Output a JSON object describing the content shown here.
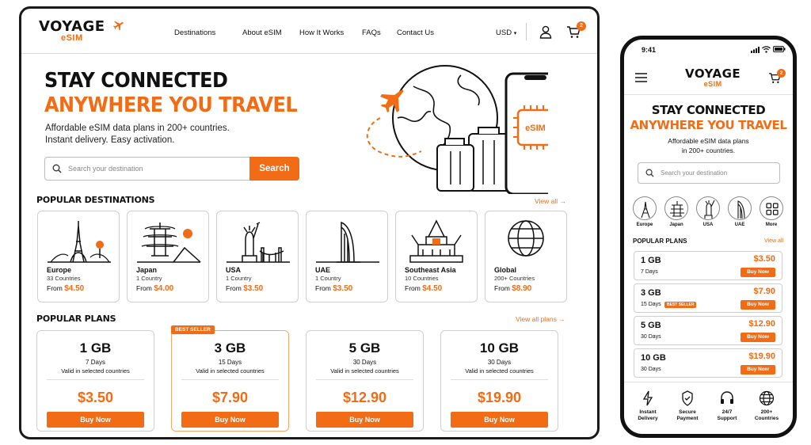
{
  "brand": {
    "name": "VOYAGE",
    "sub": "eSIM",
    "accent": "#f26c16"
  },
  "desktop": {
    "nav": [
      "Destinations",
      "About eSIM",
      "How It Works",
      "FAQs",
      "Contact Us"
    ],
    "currency": "USD",
    "cart_count": "2",
    "hero": {
      "line1": "STAY CONNECTED",
      "line2": "ANYWHERE YOU TRAVEL",
      "sub1": "Affordable eSIM data plans in 200+ countries.",
      "sub2": "Instant delivery. Easy activation.",
      "search_placeholder": "Search your destination",
      "search_button": "Search",
      "phone_label": "eSIM"
    },
    "popular_destinations": {
      "title": "POPULAR DESTINATIONS",
      "view_all": "View all →",
      "items": [
        {
          "name": "Europe",
          "count": "33 Countries",
          "from": "From",
          "price": "$4.50",
          "icon": "eiffel-tower-icon"
        },
        {
          "name": "Japan",
          "count": "1 Country",
          "from": "From",
          "price": "$4.00",
          "icon": "pagoda-icon"
        },
        {
          "name": "USA",
          "count": "1 Country",
          "from": "From",
          "price": "$3.50",
          "icon": "statue-of-liberty-icon"
        },
        {
          "name": "UAE",
          "count": "1 Country",
          "from": "From",
          "price": "$3.50",
          "icon": "burj-al-arab-icon"
        },
        {
          "name": "Southeast Asia",
          "count": "10 Countries",
          "from": "From",
          "price": "$4.50",
          "icon": "temple-icon"
        },
        {
          "name": "Global",
          "count": "200+ Countries",
          "from": "From",
          "price": "$8.90",
          "icon": "globe-icon"
        }
      ]
    },
    "popular_plans": {
      "title": "POPULAR PLANS",
      "view_all": "View all plans →",
      "best_seller": "BEST SELLER",
      "items": [
        {
          "data": "1 GB",
          "days": "7 Days",
          "valid": "Valid in selected countries",
          "price": "$3.50",
          "button": "Buy Now"
        },
        {
          "data": "3 GB",
          "days": "15 Days",
          "valid": "Valid in selected countries",
          "price": "$7.90",
          "button": "Buy Now"
        },
        {
          "data": "5 GB",
          "days": "30 Days",
          "valid": "Valid in selected countries",
          "price": "$12.90",
          "button": "Buy Now"
        },
        {
          "data": "10 GB",
          "days": "30 Days",
          "valid": "Valid in selected countries",
          "price": "$19.90",
          "button": "Buy Now"
        }
      ]
    }
  },
  "mobile": {
    "time": "9:41",
    "cart_count": "2",
    "hero": {
      "line1": "STAY CONNECTED",
      "line2": "ANYWHERE YOU TRAVEL",
      "sub1": "Affordable eSIM data plans",
      "sub2": "in 200+ countries.",
      "search_placeholder": "Search your destination"
    },
    "destinations": [
      "Europe",
      "Japan",
      "USA",
      "UAE",
      "More"
    ],
    "plans_title": "POPULAR PLANS",
    "plans_view_all": "View all",
    "best_seller": "BEST SELLER",
    "plans": [
      {
        "data": "1 GB",
        "days": "7 Days",
        "price": "$3.50",
        "button": "Buy Now"
      },
      {
        "data": "3 GB",
        "days": "15 Days",
        "price": "$7.90",
        "button": "Buy Now"
      },
      {
        "data": "5 GB",
        "days": "30 Days",
        "price": "$12.90",
        "button": "Buy Now"
      },
      {
        "data": "10 GB",
        "days": "30 Days",
        "price": "$19.90",
        "button": "Buy Now"
      }
    ],
    "features": [
      {
        "line1": "Instant",
        "line2": "Delivery",
        "icon": "lightning-icon"
      },
      {
        "line1": "Secure",
        "line2": "Payment",
        "icon": "shield-check-icon"
      },
      {
        "line1": "24/7",
        "line2": "Support",
        "icon": "headset-icon"
      },
      {
        "line1": "200+",
        "line2": "Countries",
        "icon": "globe-icon"
      }
    ]
  }
}
